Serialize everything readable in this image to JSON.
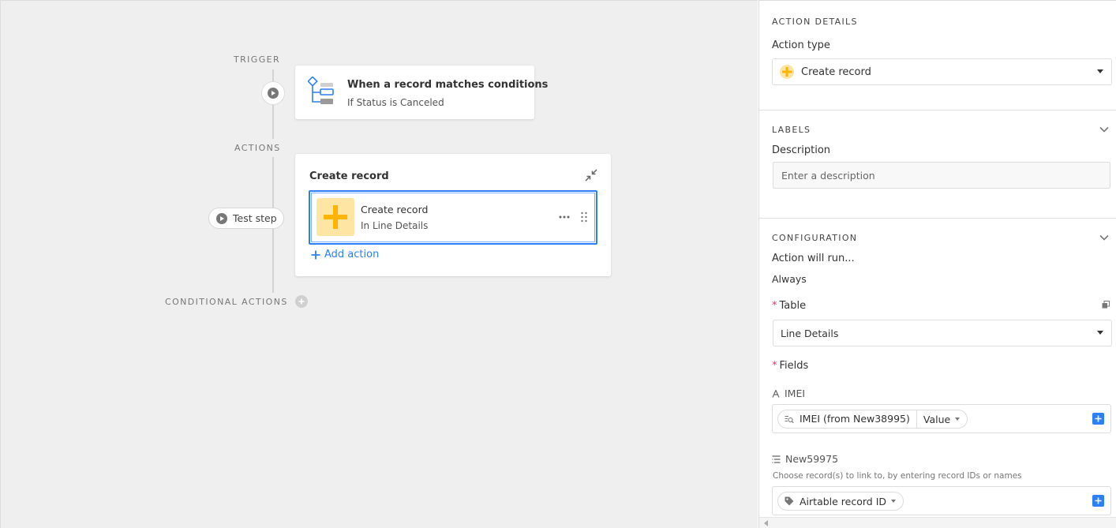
{
  "canvas": {
    "trigger_label": "TRIGGER",
    "actions_label": "ACTIONS",
    "conditional_label": "CONDITIONAL ACTIONS",
    "trigger_card": {
      "title": "When a record matches conditions",
      "subtitle": "If Status is Canceled"
    },
    "action_card": {
      "title": "Create record",
      "item_title": "Create record",
      "item_subtitle": "In Line Details",
      "add_action": "Add action"
    },
    "test_step": "Test step"
  },
  "panel": {
    "action_details_title": "ACTION DETAILS",
    "action_type_label": "Action type",
    "action_type_value": "Create record",
    "labels_title": "LABELS",
    "description_label": "Description",
    "description_placeholder": "Enter a description",
    "configuration_title": "CONFIGURATION",
    "action_will_run_label": "Action will run...",
    "action_will_run_value": "Always",
    "table_label": "Table",
    "table_value": "Line Details",
    "fields_label": "Fields",
    "field_imei": {
      "name": "IMEI",
      "token": "IMEI (from New38995)",
      "token_mode": "Value"
    },
    "field_new": {
      "name": "New59975",
      "help": "Choose record(s) to link to, by entering record IDs or names",
      "token": "Airtable record ID"
    }
  },
  "colors": {
    "accent_blue": "#2d7ff9",
    "create_yellow": "#fcb400",
    "create_tile_bg": "#ffe5a3",
    "required_red": "#ef3061",
    "canvas_bg": "#efefef"
  }
}
